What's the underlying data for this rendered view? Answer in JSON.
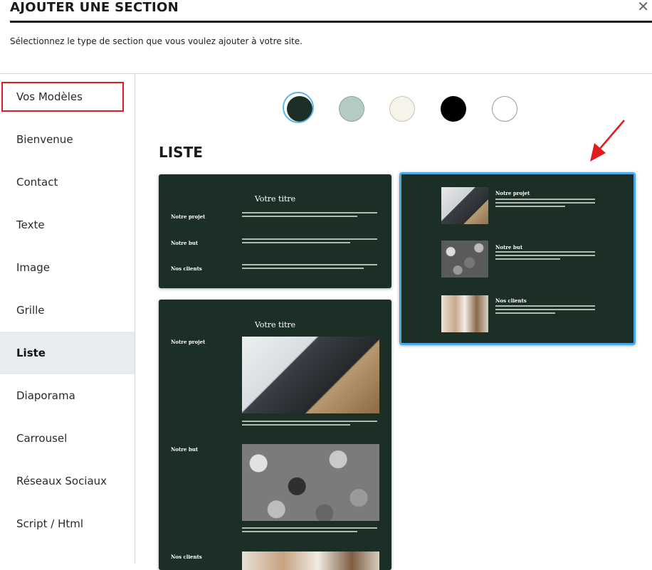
{
  "header": {
    "title": "AJOUTER UNE SECTION",
    "close_icon": "close-icon",
    "subtitle": "Sélectionnez le type de section que vous voulez ajouter à votre site."
  },
  "sidebar": {
    "items": [
      {
        "label": "Vos Modèles"
      },
      {
        "label": "Bienvenue"
      },
      {
        "label": "Contact"
      },
      {
        "label": "Texte"
      },
      {
        "label": "Image"
      },
      {
        "label": "Grille"
      },
      {
        "label": "Liste"
      },
      {
        "label": "Diaporama"
      },
      {
        "label": "Carrousel"
      },
      {
        "label": "Réseaux Sociaux"
      },
      {
        "label": "Script / Html"
      }
    ],
    "active": "Liste",
    "highlighted": "Vos Modèles"
  },
  "palette": {
    "swatches": [
      {
        "color": "#1c2f26",
        "selected": true
      },
      {
        "color": "#b3cbc2",
        "selected": false
      },
      {
        "color": "#f6f4ea",
        "selected": false
      },
      {
        "color": "#000000",
        "selected": false
      },
      {
        "color": "#ffffff",
        "selected": false
      }
    ]
  },
  "main": {
    "heading": "LISTE",
    "templates": [
      {
        "title": "Votre titre",
        "items": [
          "Notre projet",
          "Notre but",
          "Nos clients"
        ]
      },
      {
        "title": "",
        "items": [
          "Notre projet",
          "Notre but",
          "Nos clients"
        ],
        "selected": true
      },
      {
        "title": "Votre titre",
        "items": [
          "Notre projet",
          "Notre but",
          "Nos clients"
        ]
      }
    ]
  },
  "colors": {
    "accent": "#4aa8e8",
    "annotation": "#e21b1b",
    "card_bg": "#1c2f26"
  }
}
